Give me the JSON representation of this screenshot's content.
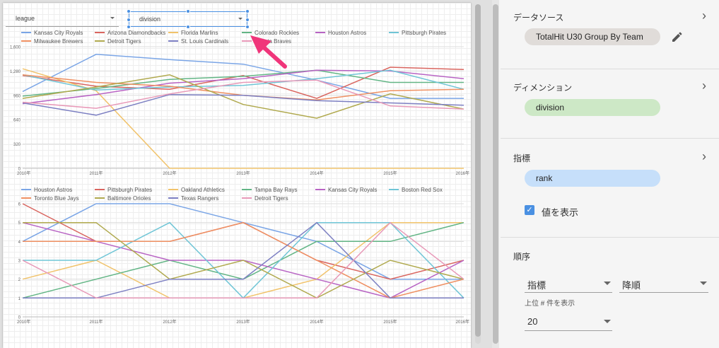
{
  "filters": {
    "league_label": "league",
    "division_label": "division"
  },
  "chart_data": [
    {
      "type": "line",
      "x": [
        "2010年",
        "2011年",
        "2012年",
        "2013年",
        "2014年",
        "2015年",
        "2016年"
      ],
      "ylim": [
        0,
        1600
      ],
      "yticks": [
        0,
        320,
        640,
        960,
        1280,
        1600
      ],
      "series": [
        {
          "name": "Kansas City Royals",
          "color": "#7aa5e6",
          "values": [
            1010,
            1500,
            1430,
            1370,
            1160,
            920,
            920
          ]
        },
        {
          "name": "Arizona Diamondbacks",
          "color": "#d9655f",
          "values": [
            1220,
            1080,
            1040,
            1220,
            920,
            1330,
            1300
          ]
        },
        {
          "name": "Florida Marlins",
          "color": "#f1c36b",
          "values": [
            1310,
            1020,
            0,
            0,
            0,
            0,
            0
          ]
        },
        {
          "name": "Colorado Rockies",
          "color": "#62b585",
          "values": [
            950,
            1050,
            1170,
            1210,
            1290,
            1130,
            1130
          ]
        },
        {
          "name": "Houston Astros",
          "color": "#b864c4",
          "values": [
            850,
            970,
            1120,
            1180,
            1290,
            1280,
            1180
          ]
        },
        {
          "name": "Pittsburgh Pirates",
          "color": "#6fc5d6",
          "values": [
            1230,
            1030,
            1070,
            1090,
            1180,
            1290,
            1040
          ]
        },
        {
          "name": "Milwaukee Brewers",
          "color": "#ef9062",
          "values": [
            1230,
            1130,
            1080,
            960,
            900,
            1020,
            1040
          ]
        },
        {
          "name": "Detroit Tigers",
          "color": "#b0a94e",
          "values": [
            920,
            1070,
            1230,
            840,
            660,
            980,
            780
          ]
        },
        {
          "name": "St. Louis Cardinals",
          "color": "#7c7fc2",
          "values": [
            860,
            700,
            970,
            960,
            890,
            860,
            830
          ]
        },
        {
          "name": "Atlanta Braves",
          "color": "#e899b8",
          "values": [
            870,
            790,
            980,
            1130,
            1160,
            820,
            780
          ]
        }
      ]
    },
    {
      "type": "line",
      "x": [
        "2010年",
        "2011年",
        "2012年",
        "2013年",
        "2014年",
        "2015年",
        "2016年"
      ],
      "ylim": [
        0,
        6
      ],
      "yticks": [
        0,
        1,
        2,
        3,
        4,
        5,
        6
      ],
      "series": [
        {
          "name": "Houston Astros",
          "color": "#7aa5e6",
          "values": [
            4,
            6,
            6,
            5,
            4,
            2,
            2
          ]
        },
        {
          "name": "Pittsburgh Pirates",
          "color": "#d9655f",
          "values": [
            6,
            4,
            4,
            5,
            3,
            2,
            3
          ]
        },
        {
          "name": "Oakland Athletics",
          "color": "#f1c36b",
          "values": [
            2,
            3,
            1,
            1,
            2,
            5,
            5
          ]
        },
        {
          "name": "Tampa Bay Rays",
          "color": "#62b585",
          "values": [
            1,
            2,
            3,
            2,
            4,
            4,
            5
          ]
        },
        {
          "name": "Kansas City Royals",
          "color": "#b864c4",
          "values": [
            5,
            4,
            3,
            3,
            2,
            1,
            3
          ]
        },
        {
          "name": "Boston Red Sox",
          "color": "#6fc5d6",
          "values": [
            3,
            3,
            5,
            1,
            5,
            5,
            1
          ]
        },
        {
          "name": "Toronto Blue Jays",
          "color": "#ef9062",
          "values": [
            4,
            4,
            4,
            5,
            3,
            1,
            2
          ]
        },
        {
          "name": "Baltimore Orioles",
          "color": "#b0a94e",
          "values": [
            5,
            5,
            2,
            3,
            1,
            3,
            2
          ]
        },
        {
          "name": "Texas Rangers",
          "color": "#7c7fc2",
          "values": [
            1,
            1,
            2,
            2,
            5,
            1,
            1
          ]
        },
        {
          "name": "Detroit Tigers",
          "color": "#e899b8",
          "values": [
            3,
            1,
            1,
            1,
            1,
            5,
            2
          ]
        }
      ]
    }
  ],
  "panel": {
    "datasource_title": "データソース",
    "datasource_value": "TotalHit U30 Group By Team",
    "dimension_title": "ディメンション",
    "dimension_value": "division",
    "metric_title": "指標",
    "metric_value": "rank",
    "show_values_label": "値を表示",
    "show_values_checked": true,
    "order_title": "順序",
    "order_field": "指標",
    "order_direction": "降順",
    "top_n_label": "上位 # 件を表示",
    "top_n_value": "20"
  },
  "colors": {
    "chip_datasource": "#e0dcd9",
    "chip_dimension": "#cde8c6",
    "chip_metric": "#c6dffa",
    "accent": "#4a90e2",
    "cursor_arrow": "#f0357a"
  },
  "icons": {
    "edit": "pencil-icon",
    "chevron": "chevron-right-icon",
    "checkbox": "checkbox-checked-icon"
  }
}
